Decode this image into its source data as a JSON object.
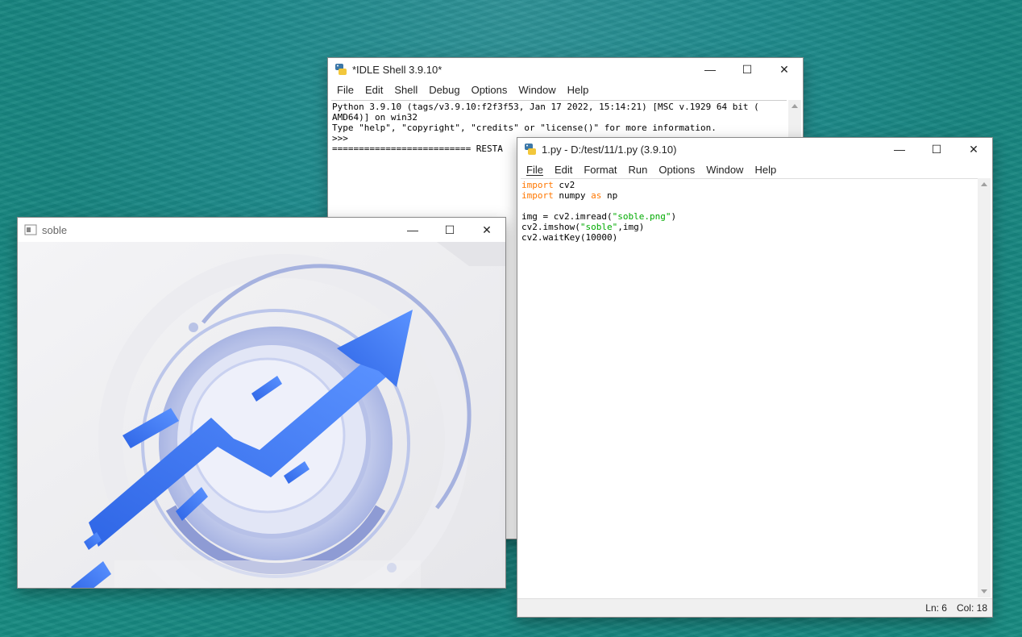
{
  "shell": {
    "title": "*IDLE Shell 3.9.10*",
    "menu": [
      "File",
      "Edit",
      "Shell",
      "Debug",
      "Options",
      "Window",
      "Help"
    ],
    "lines": [
      "Python 3.9.10 (tags/v3.9.10:f2f3f53, Jan 17 2022, 15:14:21) [MSC v.1929 64 bit (",
      "AMD64)] on win32",
      "Type \"help\", \"copyright\", \"credits\" or \"license()\" for more information.",
      ">>> ",
      "========================== RESTA"
    ]
  },
  "editor": {
    "title": "1.py - D:/test/11/1.py (3.9.10)",
    "menu": [
      "File",
      "Edit",
      "Format",
      "Run",
      "Options",
      "Window",
      "Help"
    ],
    "code": {
      "line1_kw": "import",
      "line1_rest": " cv2",
      "line2_kw": "import",
      "line2_mid": " numpy ",
      "line2_kw2": "as",
      "line2_rest": " np",
      "line4_a": "img = cv2.imread(",
      "line4_str": "\"soble.png\"",
      "line4_b": ")",
      "line5_a": "cv2.imshow(",
      "line5_str": "\"soble\"",
      "line5_b": ",img)",
      "line6": "cv2.waitKey(10000)"
    },
    "status_ln": "Ln: 6",
    "status_col": "Col: 18"
  },
  "imagewin": {
    "title": "soble"
  },
  "controls": {
    "minimize": "—",
    "maximize": "☐",
    "close": "✕"
  },
  "colors": {
    "keyword": "#ff7700",
    "string": "#00aa00",
    "arrow_blue": "#3e7bf5"
  }
}
